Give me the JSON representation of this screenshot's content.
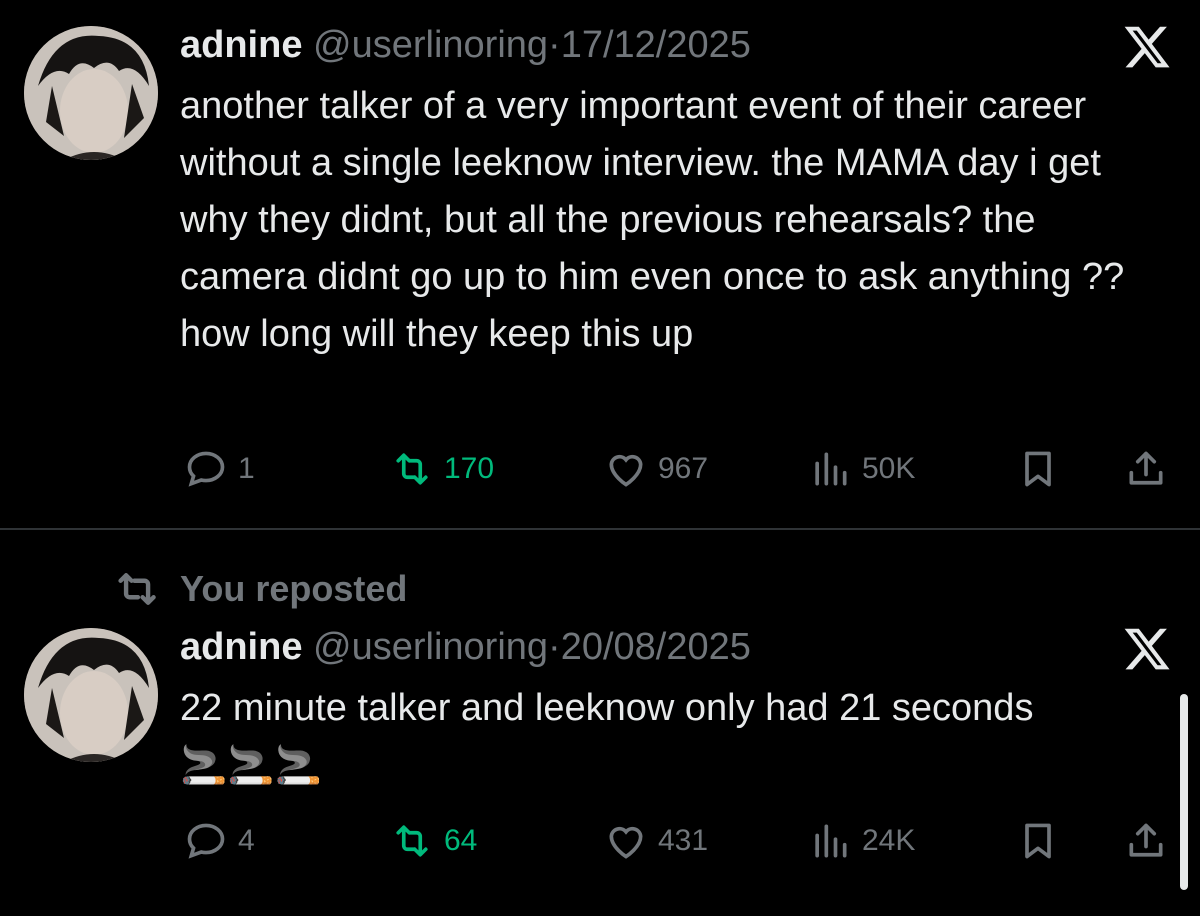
{
  "tweets": [
    {
      "name": "adnine",
      "handle": "@userlinoring",
      "separator": "·",
      "date": "17/12/2025",
      "text": "another talker of a very important event of their career without a single leeknow interview. the MAMA day i get why they didnt, but all the previous rehearsals? the camera didnt go up to him even once to ask anything ?? how long will they keep this up",
      "stats": {
        "replies": "1",
        "reposts": "170",
        "likes": "967",
        "views": "50K"
      }
    },
    {
      "repost_label": "You reposted",
      "name": "adnine",
      "handle": "@userlinoring",
      "separator": "·",
      "date": "20/08/2025",
      "text": "22 minute talker and leeknow only had 21 seconds",
      "emoji": "🚬🚬🚬",
      "stats": {
        "replies": "4",
        "reposts": "64",
        "likes": "431",
        "views": "24K"
      }
    }
  ],
  "icons": {
    "reply": "speech-bubble-icon",
    "repost": "repost-arrows-icon",
    "like": "heart-icon",
    "views": "bar-chart-icon",
    "bookmark": "bookmark-icon",
    "share": "share-upload-icon",
    "x_logo": "x-logo-icon"
  },
  "colors": {
    "background": "#000000",
    "text": "#e7e9ea",
    "muted": "#71767b",
    "repost_green": "#00ba7c",
    "divider": "#2f3336"
  }
}
